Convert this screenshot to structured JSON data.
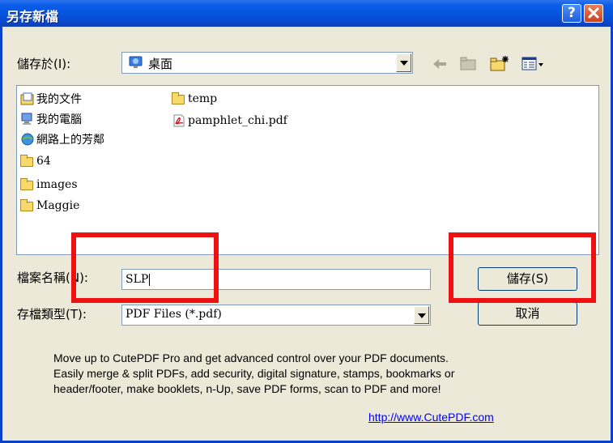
{
  "window": {
    "title": "另存新檔"
  },
  "titlebar": {
    "help_label": "?",
    "close_label": "✕"
  },
  "location": {
    "label": "儲存於(I):",
    "value": "桌面"
  },
  "files": [
    {
      "name": "我的文件",
      "icon": "my-documents-icon"
    },
    {
      "name": "我的電腦",
      "icon": "my-computer-icon"
    },
    {
      "name": "網路上的芳鄰",
      "icon": "network-places-icon"
    },
    {
      "name": "64",
      "icon": "folder-icon"
    },
    {
      "name": "images",
      "icon": "folder-icon"
    },
    {
      "name": "Maggie",
      "icon": "folder-icon"
    },
    {
      "name": "temp",
      "icon": "folder-icon"
    },
    {
      "name": "pamphlet_chi.pdf",
      "icon": "pdf-file-icon"
    }
  ],
  "filename": {
    "label": "檔案名稱(N):",
    "value": "SLP"
  },
  "filetype": {
    "label": "存檔類型(T):",
    "value": "PDF Files (*.pdf)"
  },
  "buttons": {
    "save": "儲存(S)",
    "cancel": "取消"
  },
  "promo": {
    "line1": "Move up to CutePDF Pro and get advanced control over your PDF documents.",
    "line2": "Easily merge & split PDFs, add security, digital signature, stamps, bookmarks or",
    "line3": "header/footer, make booklets, n-Up, save PDF forms, scan to PDF and more!",
    "link": "http://www.CutePDF.com"
  },
  "colors": {
    "highlight": "#ee1111",
    "titlebar": "#0553de"
  }
}
